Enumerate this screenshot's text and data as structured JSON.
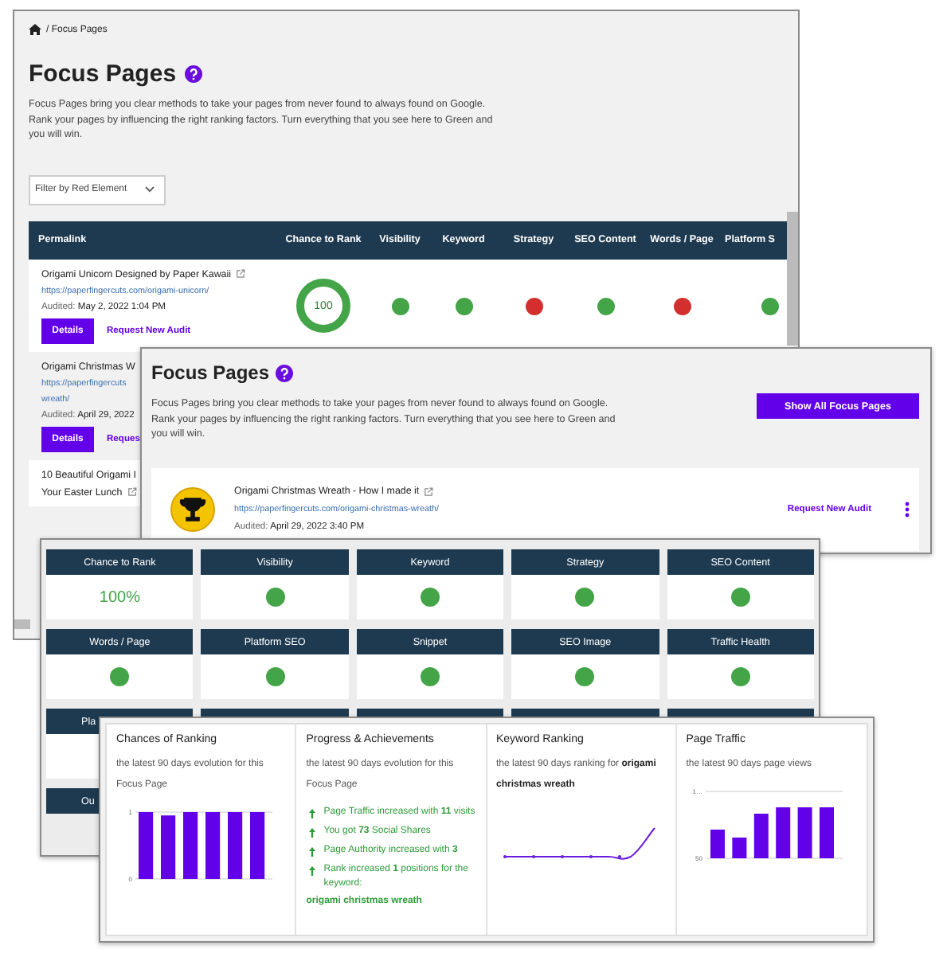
{
  "main_page": {
    "breadcrumb": "/ Focus Pages",
    "title": "Focus Pages",
    "description": "Focus Pages bring you clear methods to take your pages from never found to always found on Google. Rank your pages by influencing the right ranking factors. Turn everything that you see here to Green and you will win.",
    "filter": {
      "value": "Filter by Red Element"
    },
    "table": {
      "columns": [
        "Permalink",
        "Chance to Rank",
        "Visibility",
        "Keyword",
        "Strategy",
        "SEO Content",
        "Words / Page",
        "Platform S"
      ],
      "rows": [
        {
          "title": "Origami Unicorn Designed by Paper Kawaii",
          "url": "https://paperfingercuts.com/origami-unicorn/",
          "audited_label": "Audited:",
          "audited": "May 2, 2022 1:04 PM",
          "details": "Details",
          "audit_link": "Request New Audit",
          "score": "100",
          "dots": [
            {
              "color": "#43a547"
            },
            {
              "color": "#43a547"
            },
            {
              "color": "#d32f2f"
            },
            {
              "color": "#43a547"
            },
            {
              "color": "#d32f2f"
            },
            {
              "color": "#43a547"
            }
          ]
        },
        {
          "title": "Origami Christmas W",
          "url": "https://paperfingercuts",
          "url_2": "wreath/",
          "audited_label": "Audited:",
          "audited": "April 29, 2022",
          "details": "Details",
          "audit_link": "Reques"
        },
        {
          "title": "10 Beautiful Origami I",
          "title_2": "Your Easter Lunch"
        }
      ]
    }
  },
  "focus_panel": {
    "title": "Focus Pages",
    "description": "Focus Pages bring you clear methods to take your pages from never found to always found on Google. Rank your pages by influencing the right ranking factors. Turn everything that you see here to Green and you will win.",
    "button": "Show All Focus Pages",
    "page": {
      "title": "Origami Christmas Wreath - How I made it",
      "url": "https://paperfingercuts.com/origami-christmas-wreath/",
      "audited_label": "Audited:",
      "audited": "April 29, 2022 3:40 PM",
      "audit_link": "Request New Audit"
    }
  },
  "metrics": {
    "cells": [
      {
        "label": "Chance to Rank",
        "kind": "value",
        "value": "100%"
      },
      {
        "label": "Visibility",
        "kind": "dot",
        "color": "#43a547"
      },
      {
        "label": "Keyword",
        "kind": "dot",
        "color": "#43a547"
      },
      {
        "label": "Strategy",
        "kind": "dot",
        "color": "#43a547"
      },
      {
        "label": "SEO Content",
        "kind": "dot",
        "color": "#43a547"
      },
      {
        "label": "Words / Page",
        "kind": "dot",
        "color": "#43a547"
      },
      {
        "label": "Platform SEO",
        "kind": "dot",
        "color": "#43a547"
      },
      {
        "label": "Snippet",
        "kind": "dot",
        "color": "#43a547"
      },
      {
        "label": "SEO Image",
        "kind": "dot",
        "color": "#43a547"
      },
      {
        "label": "Traffic Health",
        "kind": "dot",
        "color": "#43a547"
      }
    ],
    "partial_headers": [
      "Pla",
      "Ou"
    ]
  },
  "summary": {
    "cards": [
      {
        "kind": "bar_chart",
        "title": "Chances of Ranking",
        "subtitle": "the latest 90 days evolution for this Focus Page",
        "chart_data": {
          "type": "bar",
          "values": [
            1,
            0.95,
            1,
            1,
            1,
            1
          ],
          "ylim": [
            0,
            1
          ],
          "yticks": [
            {
              "value": 0,
              "label": "0"
            },
            {
              "value": 1,
              "label": "1"
            }
          ]
        }
      },
      {
        "kind": "progress",
        "title": "Progress & Achievements",
        "subtitle": "the latest 90 days evolution for this Focus Page",
        "items": [
          "Page Traffic increased with **11** visits",
          "You got **73** Social Shares",
          "Page Authority increased with **3**",
          "Rank increased **1** positions for the keyword:"
        ],
        "keyword": "origami christmas wreath"
      },
      {
        "kind": "line",
        "title": "Keyword Ranking",
        "subtitle": "the latest 90 days ranking for **origami christmas wreath**"
      },
      {
        "kind": "bar_picture",
        "title": "Page Traffic",
        "subtitle": "the latest 90 days page views",
        "axis_labels": [
          "1…",
          "50"
        ]
      }
    ]
  }
}
